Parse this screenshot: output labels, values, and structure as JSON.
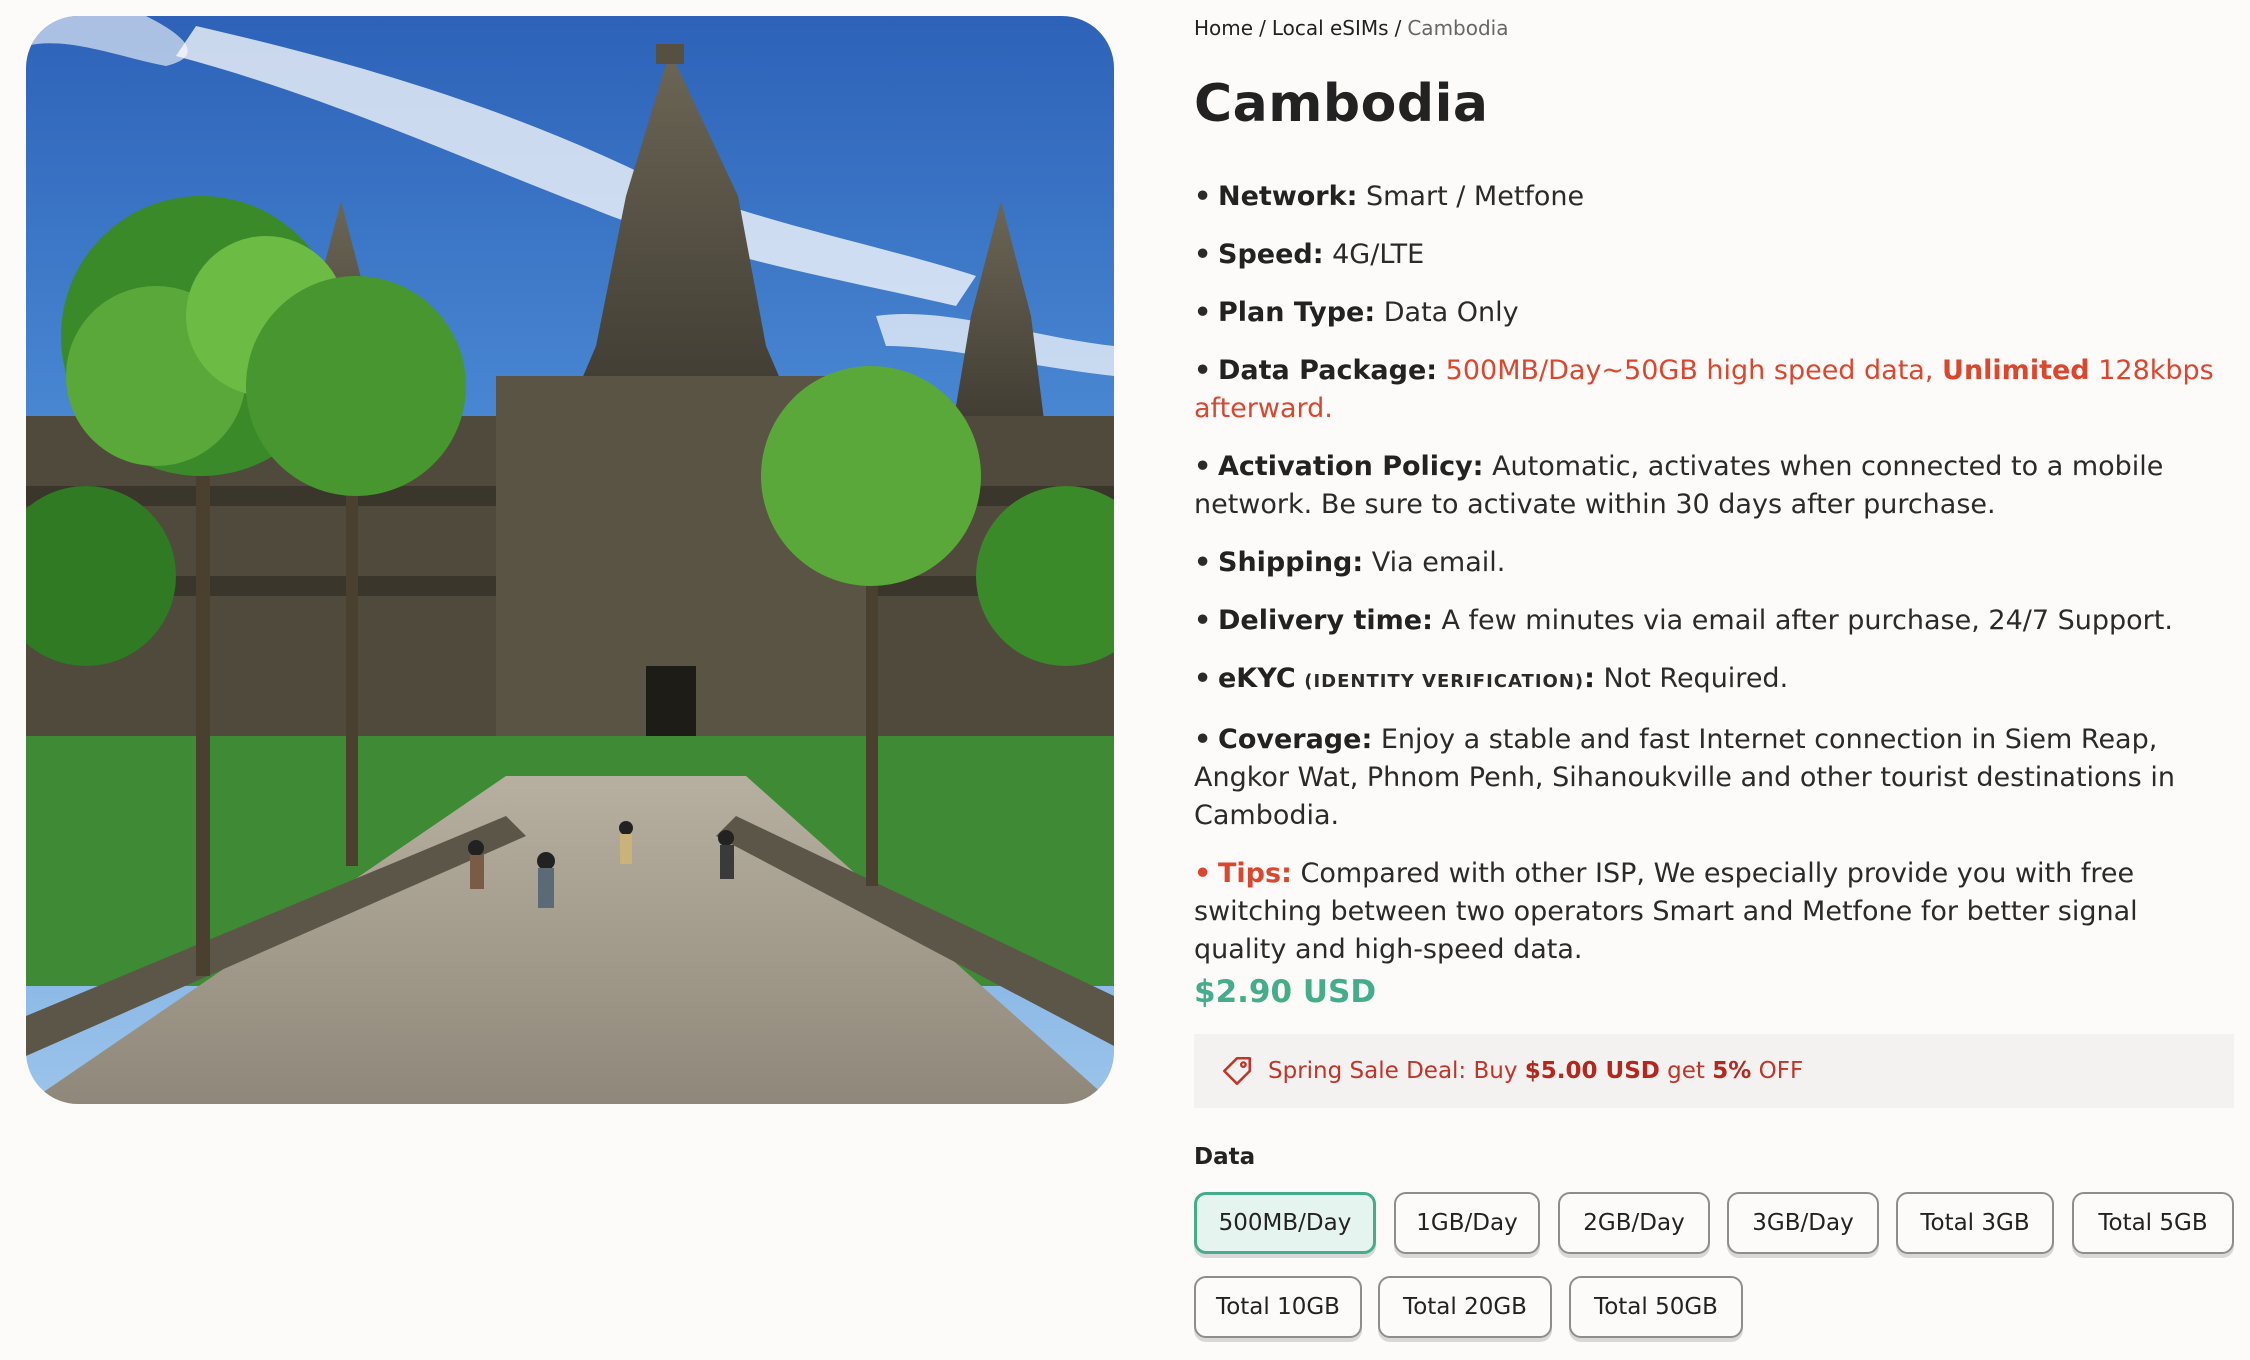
{
  "breadcrumb": {
    "home": "Home",
    "category": "Local eSIMs",
    "current": "Cambodia",
    "separator": "/"
  },
  "product": {
    "title": "Cambodia",
    "image_alt": "Angkor Wat temple with palm trees"
  },
  "features": {
    "network": {
      "label": "Network:",
      "value": "Smart / Metfone"
    },
    "speed": {
      "label": "Speed:",
      "value": "4G/LTE"
    },
    "plan_type": {
      "label": "Plan Type:",
      "value": "Data Only"
    },
    "data_package": {
      "label": "Data Package:",
      "value_pre": "500MB/Day~50GB high speed data,",
      "value_bold": "Unlimited",
      "value_post": "128kbps afterward."
    },
    "activation": {
      "label": "Activation Policy:",
      "value": "Automatic, activates when connected to a mobile network. Be sure to activate within 30 days after purchase."
    },
    "shipping": {
      "label": "Shipping:",
      "value": "Via email."
    },
    "delivery": {
      "label": "Delivery time:",
      "value": "A few minutes via email after purchase, 24/7 Support."
    },
    "ekyc": {
      "label": "eKYC",
      "sub": "(IDENTITY VERIFICATION)",
      "colon": ":",
      "value": "Not Required."
    },
    "coverage": {
      "label": "Coverage:",
      "value": "Enjoy a stable and fast Internet connection in Siem Reap, Angkor Wat, Phnom Penh, Sihanoukville and other tourist destinations in Cambodia."
    },
    "tips": {
      "label": "Tips:",
      "value": "Compared with other ISP, We especially provide you with free switching between two operators Smart and Metfone for better signal quality and high-speed data."
    }
  },
  "price": "$2.90 USD",
  "deal": {
    "pre": "Spring Sale Deal: Buy",
    "amount": "$5.00 USD",
    "mid": "get",
    "percent": "5%",
    "post": "OFF"
  },
  "data_selector": {
    "label": "Data",
    "selected": "500MB/Day",
    "options": [
      "500MB/Day",
      "1GB/Day",
      "2GB/Day",
      "3GB/Day",
      "Total 3GB",
      "Total 5GB",
      "Total 10GB",
      "Total 20GB",
      "Total 50GB"
    ]
  },
  "colors": {
    "accent_green": "#45ac8c",
    "alert_red": "#d9472f",
    "background": "#fcfbf9"
  },
  "icons": {
    "deal": "price-tag-icon",
    "bullet": "bullet-dot"
  }
}
